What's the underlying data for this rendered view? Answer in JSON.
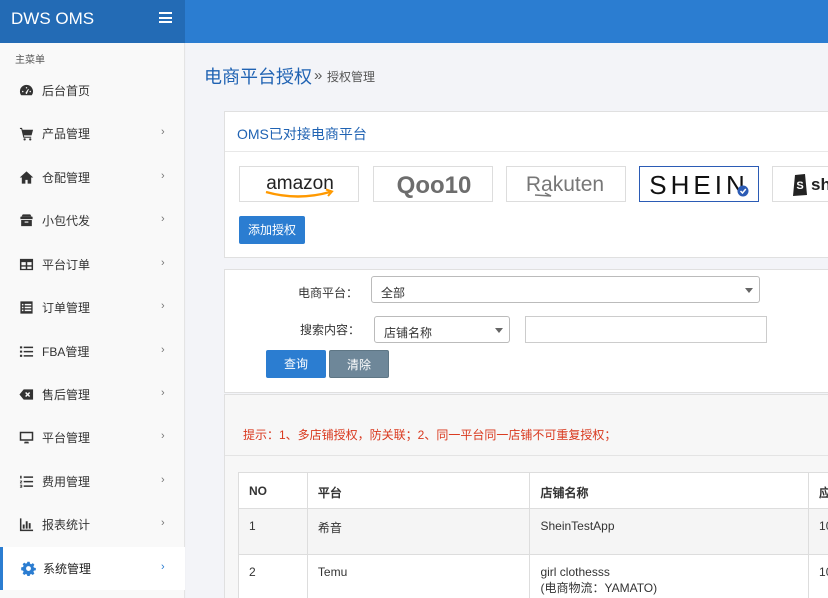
{
  "app": {
    "brand": "DWS OMS"
  },
  "sidebar": {
    "caption": "主菜单",
    "items": [
      {
        "label": "后台首页",
        "icon": "dashboard-icon",
        "chevron": ""
      },
      {
        "label": "产品管理",
        "icon": "cart-icon",
        "chevron": "›"
      },
      {
        "label": "仓配管理",
        "icon": "home-icon",
        "chevron": "›"
      },
      {
        "label": "小包代发",
        "icon": "package-icon",
        "chevron": "›"
      },
      {
        "label": "平台订单",
        "icon": "grid-icon",
        "chevron": "›"
      },
      {
        "label": "订单管理",
        "icon": "list-box-icon",
        "chevron": "›"
      },
      {
        "label": "FBA管理",
        "icon": "list-icon",
        "chevron": "›"
      },
      {
        "label": "售后管理",
        "icon": "backspace-icon",
        "chevron": "›"
      },
      {
        "label": "平台管理",
        "icon": "monitor-icon",
        "chevron": "›"
      },
      {
        "label": "费用管理",
        "icon": "list-ordered-icon",
        "chevron": "›"
      },
      {
        "label": "报表统计",
        "icon": "bar-chart-icon",
        "chevron": "›"
      },
      {
        "label": "系统管理",
        "icon": "gear-icon",
        "chevron": "›",
        "active": true
      }
    ]
  },
  "page": {
    "title": "电商平台授权",
    "breadcrumb_sep": "»",
    "breadcrumb_current": "授权管理"
  },
  "platforms": {
    "title": "OMS已对接电商平台",
    "logos": [
      "amazon",
      "Qoo10",
      "Rakuten",
      "SHEIN",
      "sh"
    ],
    "add_button": "添加授权"
  },
  "filter": {
    "platform_label": "电商平台：",
    "platform_value": "全部",
    "search_label": "搜索内容：",
    "search_type_value": "店铺名称",
    "search_input_value": "",
    "query_button": "查询",
    "clear_button": "清除"
  },
  "list": {
    "tip": "提示：1、多店铺授权，防关联；2、同一平台同一店铺不可重复授权；",
    "columns": [
      "NO",
      "平台",
      "店铺名称",
      "应"
    ],
    "rows": [
      {
        "no": "1",
        "platform": "希音",
        "shop": "SheinTestApp",
        "shop_note": "",
        "extra": "10"
      },
      {
        "no": "2",
        "platform": "Temu",
        "shop": "girl clothesss",
        "shop_note": "(电商物流：YAMATO)",
        "extra": "10"
      }
    ]
  },
  "colors": {
    "accent": "#2b7dd1",
    "brand_bg": "#236bb5",
    "tip": "#d9391f",
    "clear_button": "#6e8799"
  }
}
